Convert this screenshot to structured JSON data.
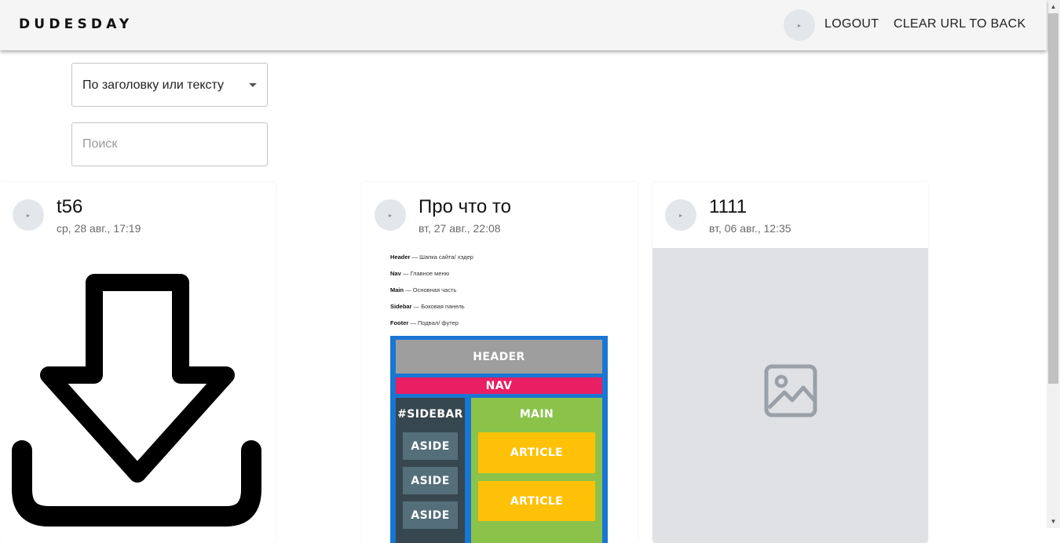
{
  "appbar": {
    "brand": "DUDESDAY",
    "avatar_icon": "avatar-placeholder-icon",
    "logout_label": "LOGOUT",
    "clear_url_label": "CLEAR URL TO BACK"
  },
  "filters": {
    "select_value": "По заголовку или тексту",
    "search_placeholder": "Поиск",
    "search_value": ""
  },
  "cards": [
    {
      "title": "t56",
      "date": "ср, 28 авг., 17:19",
      "media_icon": "download-icon"
    },
    {
      "title": "Про что то",
      "date": "вт, 27 авг., 22:08",
      "media": {
        "legend": [
          {
            "term": "Header",
            "desc": "— Шапка сайта/ хэдер"
          },
          {
            "term": "Nav",
            "desc": "— Главное меню"
          },
          {
            "term": "Main",
            "desc": "— Основная часть"
          },
          {
            "term": "Sidebar",
            "desc": "— Боковая панель"
          },
          {
            "term": "Footer",
            "desc": "— Подвал/ футер"
          }
        ],
        "blocks": {
          "header": "HEADER",
          "nav": "NAV",
          "sidebar": "#SIDEBAR",
          "main": "MAIN",
          "aside": "ASIDE",
          "article": "ARTICLE"
        }
      }
    },
    {
      "title": "1111",
      "date": "вт, 06 авг., 12:35",
      "media_icon": "image-placeholder-icon"
    }
  ],
  "colors": {
    "appbar_bg": "#f5f5f5",
    "layout_frame": "#1976d2",
    "header_block": "#9e9e9e",
    "nav_block": "#e91e63",
    "sidebar_block": "#37474f",
    "aside_block": "#546e7a",
    "main_block": "#8bc34a",
    "article_block": "#ffc107",
    "placeholder_bg": "#dfe1e4"
  }
}
